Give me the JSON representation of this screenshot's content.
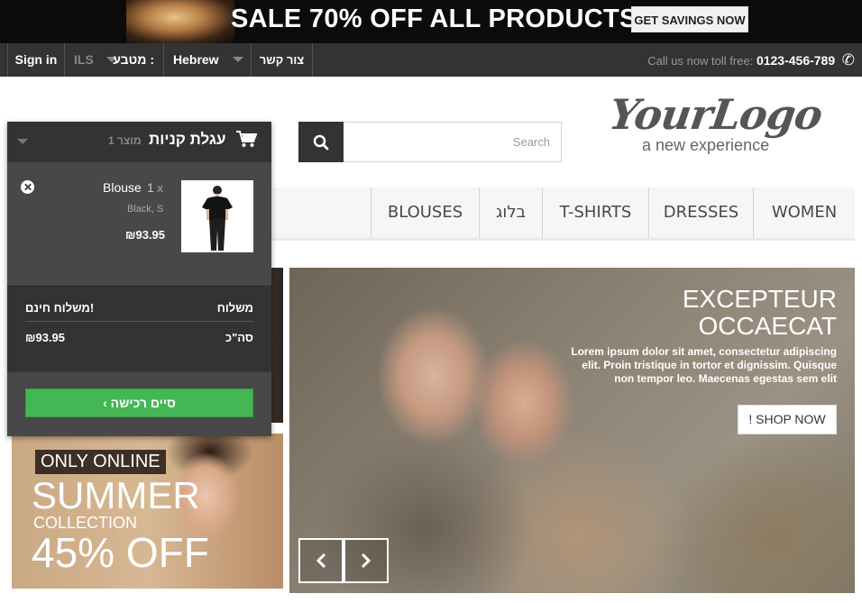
{
  "banner": {
    "text": "SALE 70% OFF ALL PRODUCTS",
    "button_label": "GET SAVINGS NOW"
  },
  "topnav": {
    "signin_label": "Sign in",
    "currency_value": "ILS",
    "currency_label": "מטבע :",
    "language_value": "Hebrew",
    "contact_label": "צור קשר",
    "phone_prefix": "Call us now toll free:",
    "phone_number": "0123-456-789"
  },
  "logo": {
    "main": "YourLogo",
    "tagline": "a new experience"
  },
  "search": {
    "placeholder": "Search"
  },
  "menu": {
    "items": [
      "BLOUSES",
      "בלוג",
      "T-SHIRTS",
      "DRESSES",
      "WOMEN"
    ]
  },
  "cart": {
    "title": "עגלת קניות",
    "count": "1 מוצר",
    "item": {
      "qty": "1",
      "qty_symbol": "x",
      "name": "Blouse",
      "attributes": "Black, S",
      "price": "₪93.95"
    },
    "shipping_label": "משלוח",
    "shipping_value": "משלוח חינם!",
    "total_label": "סה\"כ",
    "total_value": "₪93.95",
    "checkout_label": "סיים רכישה"
  },
  "hero": {
    "title": "EXCEPTEUR OCCAECAT",
    "text": "Lorem ipsum dolor sit amet, consectetur adipiscing elit. Proin tristique in tortor et dignissim. Quisque non tempor leo. Maecenas egestas sem elit",
    "button_label": "! SHOP NOW"
  },
  "promo": {
    "badge": "ONLY ONLINE",
    "headline": "SUMMER",
    "subline": "COLLECTION",
    "discount": "45% OFF"
  },
  "colors": {
    "dark": "#333333",
    "checkout_green": "#43b754",
    "menu_bg": "#f6f6f6"
  }
}
